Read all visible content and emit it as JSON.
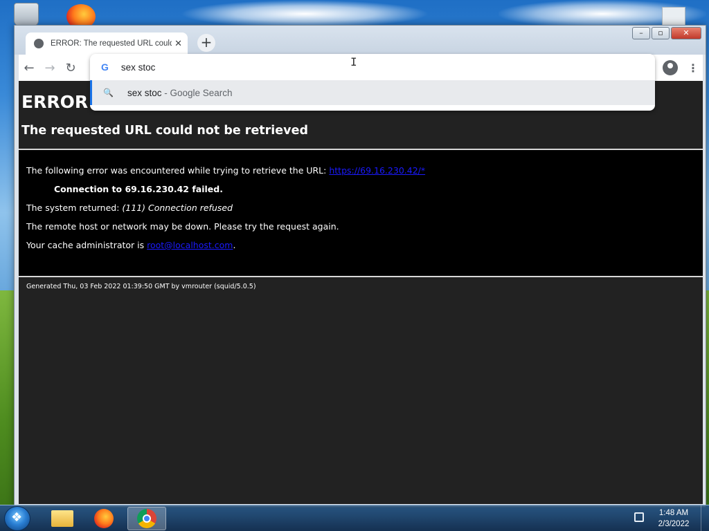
{
  "browser": {
    "tab_title": "ERROR: The requested URL could not be retrieved",
    "omnibox": {
      "value": "sex stoc",
      "suggestion_query": "sex stoc",
      "suggestion_sub": " - Google Search"
    }
  },
  "page": {
    "heading": "ERROR",
    "subheading": "The requested URL could not be retrieved",
    "line1_text": "The following error was encountered while trying to retrieve the URL: ",
    "line1_link": "https://69.16.230.42/*",
    "line2": "Connection to 69.16.230.42 failed.",
    "line3_text": "The system returned: ",
    "line3_italic": "(111) Connection refused",
    "line4": "The remote host or network may be down. Please try the request again.",
    "line5_text": "Your cache administrator is ",
    "line5_link": "root@localhost.com",
    "line5_end": ".",
    "footer": "Generated Thu, 03 Feb 2022 01:39:50 GMT by vmrouter (squid/5.0.5)"
  },
  "taskbar": {
    "time": "1:48 AM",
    "date": "2/3/2022"
  },
  "icons": {
    "back": "←",
    "forward": "→",
    "reload": "↻",
    "new_tab": "+",
    "tab_close": "✕",
    "search": "🔍",
    "google": "G",
    "minimize": "–",
    "maximize": "▫",
    "close": "✕",
    "menu": "⋮"
  }
}
